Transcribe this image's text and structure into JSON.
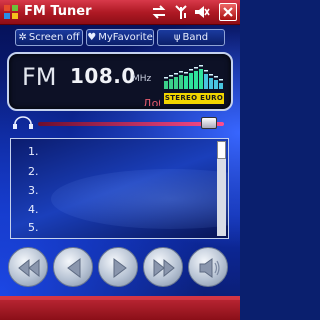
{
  "window": {
    "title": "FM Tuner"
  },
  "tabs": [
    {
      "label": "Screen off",
      "icon": "gear-icon"
    },
    {
      "label": "MyFavorite",
      "icon": "heart-icon"
    },
    {
      "label": "Band",
      "icon": "antenna-icon"
    }
  ],
  "display": {
    "band": "FM",
    "frequency": "108.0",
    "unit": "MHz",
    "rds_text": "Добро",
    "mode_badge": "STEREO EURO",
    "signal_bars": [
      8,
      10,
      12,
      14,
      13,
      16,
      18,
      20,
      15,
      11,
      9,
      6
    ]
  },
  "volume": {
    "level": 0.96
  },
  "favorites": {
    "items": [
      "1.",
      "2.",
      "3.",
      "4.",
      "5."
    ]
  },
  "controls": [
    {
      "name": "rewind-button",
      "icon": "rewind-icon"
    },
    {
      "name": "prev-button",
      "icon": "prev-icon"
    },
    {
      "name": "play-button",
      "icon": "play-icon"
    },
    {
      "name": "fast-forward-button",
      "icon": "fast-forward-icon"
    },
    {
      "name": "mute-button",
      "icon": "speaker-icon"
    }
  ],
  "colors": {
    "titlebar": "#b01a25",
    "badge": "#f2d500",
    "rds": "#e35b6c",
    "volume_track": "#ff4d8d"
  }
}
